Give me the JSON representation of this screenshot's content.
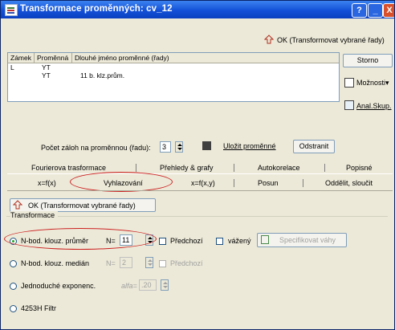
{
  "window": {
    "title": "Transformace proměnných: cv_12"
  },
  "titlebar_buttons": {
    "help": "?",
    "minimize": "_",
    "close": "X"
  },
  "top_button": {
    "label": "OK (Transformovat vybrané řady)"
  },
  "list": {
    "headers": [
      "Zámek",
      "Proměnná",
      "Dlouhé jméno proměnné (řady)"
    ],
    "rows": [
      {
        "lock": "L",
        "variable": "YT",
        "long_name": ""
      },
      {
        "lock": "",
        "variable": "YT",
        "long_name": "11 b. klz.prům."
      }
    ]
  },
  "side_buttons": {
    "cancel": "Storno",
    "options": "Možnosti▾",
    "analysis": "Anal.Skup."
  },
  "backups": {
    "label": "Počet záloh na proměnnou (řadu):",
    "value": "3",
    "save_label": "Uložit proměnné",
    "remove_label": "Odstranit"
  },
  "tabs_row1": [
    "Fourierova trasformace",
    "Přehledy & grafy",
    "Autokorelace",
    "Popisné"
  ],
  "tabs_row2": [
    "x=f(x)",
    "Vyhlazování",
    "x=f(x,y)",
    "Posun",
    "Oddělit, sloučit"
  ],
  "ok_button": {
    "label": "OK (Transformovat vybrané řady)"
  },
  "group": {
    "title": "Transformace"
  },
  "options": {
    "moving_avg": {
      "label": "N-bod. klouz. průměr",
      "n_label": "N=",
      "n_value": "11",
      "previous_label": "Předchozí",
      "weighted_label": "vážený",
      "specify_weights_label": "Specifikovat váhy"
    },
    "moving_median": {
      "label": "N-bod. klouz. medián",
      "n_label": "N=",
      "n_value": "2",
      "previous_label": "Předchozí"
    },
    "exponential": {
      "label": "Jednoduché exponenc.",
      "alpha_label": "alfa=",
      "alpha_value": ".20"
    },
    "filter": {
      "label": "4253H Filtr"
    }
  },
  "colors": {
    "title_bar": "#1351d8",
    "highlight_oval": "#cc2020",
    "face": "#ece9d8"
  }
}
